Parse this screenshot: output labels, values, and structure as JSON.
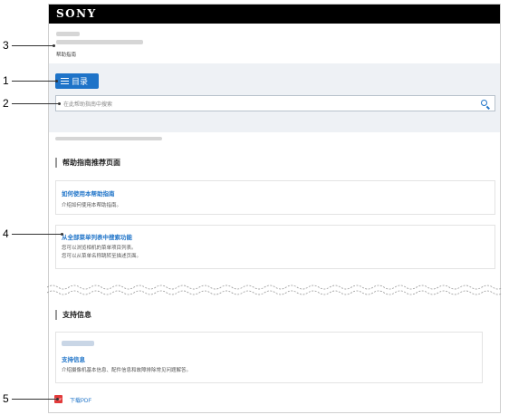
{
  "header": {
    "brand": "SONY",
    "subtitle": "帮助指南"
  },
  "toolbar": {
    "toc_label": "目录"
  },
  "search": {
    "placeholder": "在此帮助指南中搜索"
  },
  "callouts": [
    "1",
    "2",
    "3",
    "4",
    "5"
  ],
  "recommended": {
    "heading": "帮助指南推荐页面",
    "cards": [
      {
        "title": "如何使用本帮助指南",
        "desc": [
          "介绍如何使用本帮助指南。"
        ]
      },
      {
        "title": "从全部菜单列表中搜索功能",
        "desc": [
          "您可以浏览相机的菜单项目列表。",
          "您可以从菜单名称跳转至描述页面。"
        ]
      }
    ]
  },
  "support": {
    "heading": "支持信息",
    "card": {
      "title": "支持信息",
      "desc": "介绍摄像机基本信息、配件信息和故障排除常见问题解答。"
    }
  },
  "footer": {
    "pdf_icon": "PDF",
    "pdf_link": "下载PDF"
  },
  "colors": {
    "accent": "#1e73c8",
    "topbar": "#000000",
    "band": "#eef1f5"
  }
}
